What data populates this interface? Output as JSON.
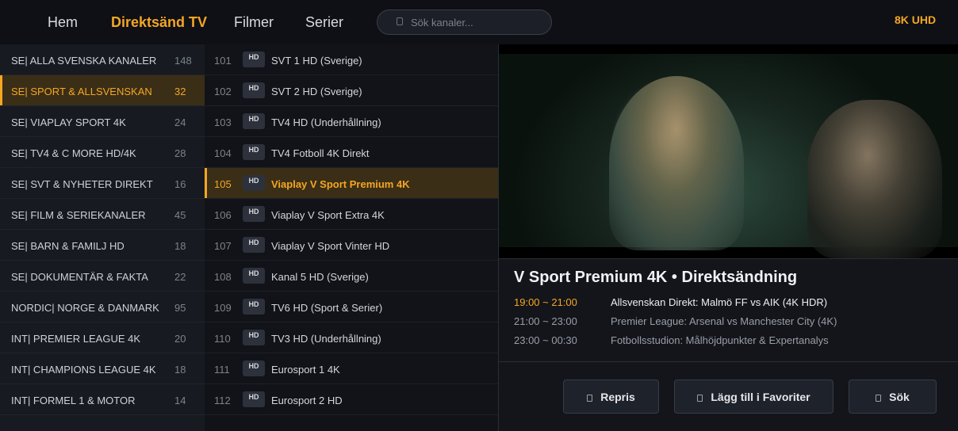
{
  "nav": {
    "items": [
      {
        "label": "Hem",
        "active": false
      },
      {
        "label": "Direktsänd TV",
        "active": true
      },
      {
        "label": "Filmer",
        "active": false
      },
      {
        "label": "Serier",
        "active": false
      }
    ],
    "search_placeholder": "Sök kanaler...",
    "search_icon": "search-icon",
    "quality_badge": "8K UHD",
    "accent_color": "#f5a623"
  },
  "categories": [
    {
      "label": "SE| ALLA SVENSKA KANALER",
      "count": "148"
    },
    {
      "label": "SE| SPORT & ALLSVENSKAN",
      "count": "32",
      "active": true
    },
    {
      "label": "SE| VIAPLAY SPORT 4K",
      "count": "24"
    },
    {
      "label": "SE| TV4 & C MORE HD/4K",
      "count": "28"
    },
    {
      "label": "SE| SVT & NYHETER DIREKT",
      "count": "16"
    },
    {
      "label": "SE| FILM & SERIEKANALER",
      "count": "45"
    },
    {
      "label": "SE| BARN & FAMILJ HD",
      "count": "18"
    },
    {
      "label": "SE| DOKUMENTÄR & FAKTA",
      "count": "22"
    },
    {
      "label": "NORDIC| NORGE & DANMARK",
      "count": "95"
    },
    {
      "label": "INT| PREMIER LEAGUE 4K",
      "count": "20"
    },
    {
      "label": "INT| CHAMPIONS LEAGUE 4K",
      "count": "18"
    },
    {
      "label": "INT| FORMEL 1 & MOTOR",
      "count": "14"
    }
  ],
  "channels": [
    {
      "num": "101",
      "badge": "HD",
      "name": "SVT 1 HD (Sverige)"
    },
    {
      "num": "102",
      "badge": "HD",
      "name": "SVT 2 HD (Sverige)"
    },
    {
      "num": "103",
      "badge": "HD",
      "name": "TV4 HD (Underhållning)"
    },
    {
      "num": "104",
      "badge": "HD",
      "name": "TV4 Fotboll 4K Direkt"
    },
    {
      "num": "105",
      "badge": "HD",
      "name": "Viaplay V Sport Premium 4K",
      "active": true
    },
    {
      "num": "106",
      "badge": "HD",
      "name": "Viaplay V Sport Extra 4K"
    },
    {
      "num": "107",
      "badge": "HD",
      "name": "Viaplay V Sport Vinter HD"
    },
    {
      "num": "108",
      "badge": "HD",
      "name": "Kanal 5 HD (Sverige)"
    },
    {
      "num": "109",
      "badge": "HD",
      "name": "TV6 HD (Sport & Serier)"
    },
    {
      "num": "110",
      "badge": "HD",
      "name": "TV3 HD (Underhållning)"
    },
    {
      "num": "111",
      "badge": "HD",
      "name": "Eurosport 1 4K"
    },
    {
      "num": "112",
      "badge": "HD",
      "name": "Eurosport 2 HD"
    }
  ],
  "now_playing": {
    "title": "V Sport Premium 4K  •  Direktsändning",
    "epg": [
      {
        "time": "19:00 ~ 21:00",
        "program": "Allsvenskan Direkt: Malmö FF vs AIK (4K HDR)",
        "current": true
      },
      {
        "time": "21:00 ~ 23:00",
        "program": "Premier League: Arsenal vs Manchester City (4K)"
      },
      {
        "time": "23:00 ~ 00:30",
        "program": "Fotbollsstudion: Målhöjdpunkter & Expertanalys"
      }
    ]
  },
  "actions": [
    {
      "label": "Repris",
      "icon": "replay-icon"
    },
    {
      "label": "Lägg till i Favoriter",
      "icon": "favorite-icon"
    },
    {
      "label": "Sök",
      "icon": "search-icon"
    }
  ]
}
